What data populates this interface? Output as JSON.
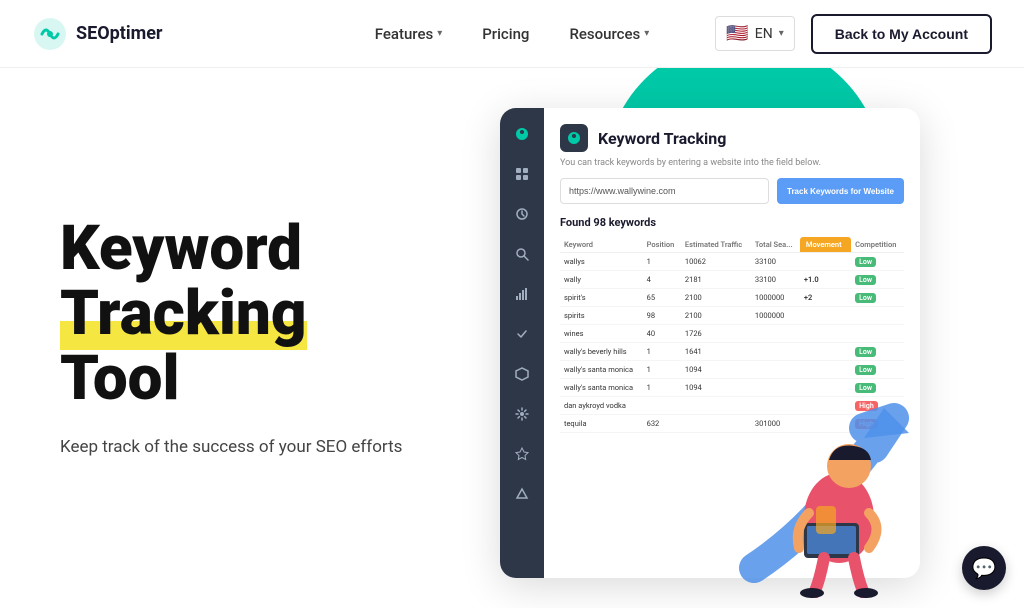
{
  "nav": {
    "logo_text": "SEOptimer",
    "links": [
      {
        "label": "Features",
        "has_dropdown": true
      },
      {
        "label": "Pricing",
        "has_dropdown": false
      },
      {
        "label": "Resources",
        "has_dropdown": true
      }
    ],
    "lang_code": "EN",
    "back_btn_label": "Back to My Account"
  },
  "hero": {
    "title_line1": "Keyword",
    "title_line2": "Tracking",
    "title_line3": "Tool",
    "subtitle": "Keep track of the success of your SEO efforts"
  },
  "dashboard": {
    "title": "Keyword Tracking",
    "subtitle": "You can track keywords by entering a website into the field below.",
    "url_placeholder": "https://www.wallywine.com",
    "track_btn_label": "Track Keywords for Website",
    "found_text": "Found 98 keywords",
    "columns": [
      "Keyword",
      "Position",
      "Estimated Traffic",
      "Total Sea...",
      "Movement",
      "Competition"
    ],
    "rows": [
      {
        "keyword": "wallys",
        "position": "1",
        "traffic": "10062",
        "total": "33100",
        "movement": "",
        "competition": "Low"
      },
      {
        "keyword": "wally",
        "position": "4",
        "traffic": "2181",
        "total": "33100",
        "movement": "+1.0",
        "competition": "Low"
      },
      {
        "keyword": "spirit's",
        "position": "65",
        "traffic": "2100",
        "total": "1000000",
        "movement": "+2",
        "competition": "Low"
      },
      {
        "keyword": "spirits",
        "position": "98",
        "traffic": "2100",
        "total": "1000000",
        "movement": "",
        "competition": ""
      },
      {
        "keyword": "wines",
        "position": "40",
        "traffic": "1726",
        "total": "",
        "movement": "",
        "competition": ""
      },
      {
        "keyword": "wally's beverly hills",
        "position": "1",
        "traffic": "1641",
        "total": "",
        "movement": "",
        "competition": "Low"
      },
      {
        "keyword": "wally's santa monica",
        "position": "1",
        "traffic": "1094",
        "total": "",
        "movement": "",
        "competition": "Low"
      },
      {
        "keyword": "wally's santa monica",
        "position": "1",
        "traffic": "1094",
        "total": "",
        "movement": "",
        "competition": "Low"
      },
      {
        "keyword": "dan aykroyd vodka",
        "position": "",
        "traffic": "",
        "total": "",
        "movement": "",
        "competition": "High"
      },
      {
        "keyword": "tequila",
        "position": "632",
        "traffic": "",
        "total": "301000",
        "movement": "",
        "competition": "High"
      }
    ]
  },
  "chat": {
    "icon": "💬"
  }
}
